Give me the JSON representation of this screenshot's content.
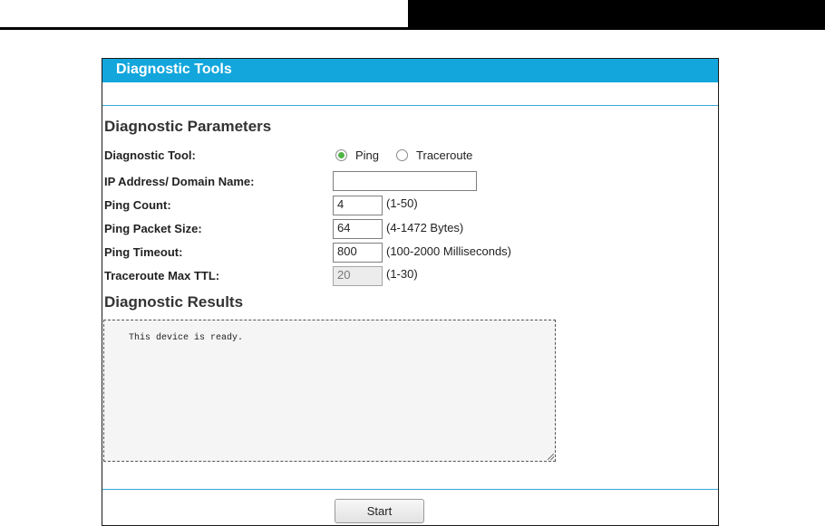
{
  "panel": {
    "title": "Diagnostic Tools"
  },
  "params": {
    "section_title": "Diagnostic Parameters",
    "tool_label": "Diagnostic Tool:",
    "tool_options": [
      {
        "label": "Ping",
        "selected": true
      },
      {
        "label": "Traceroute",
        "selected": false
      }
    ],
    "ip_label": "IP Address/ Domain Name:",
    "ip_value": "",
    "ping_count_label": "Ping Count:",
    "ping_count_value": "4",
    "ping_count_hint": "(1-50)",
    "packet_size_label": "Ping Packet Size:",
    "packet_size_value": "64",
    "packet_size_hint": "(4-1472 Bytes)",
    "timeout_label": "Ping Timeout:",
    "timeout_value": "800",
    "timeout_hint": "(100-2000 Milliseconds)",
    "ttl_label": "Traceroute Max TTL:",
    "ttl_value": "20",
    "ttl_hint": "(1-30)"
  },
  "results": {
    "section_title": "Diagnostic Results",
    "text": "This device is ready."
  },
  "actions": {
    "start_label": "Start"
  },
  "colors": {
    "header": "#12a6dc",
    "divider": "#35a8d8",
    "radio_selected": "#52b448"
  }
}
